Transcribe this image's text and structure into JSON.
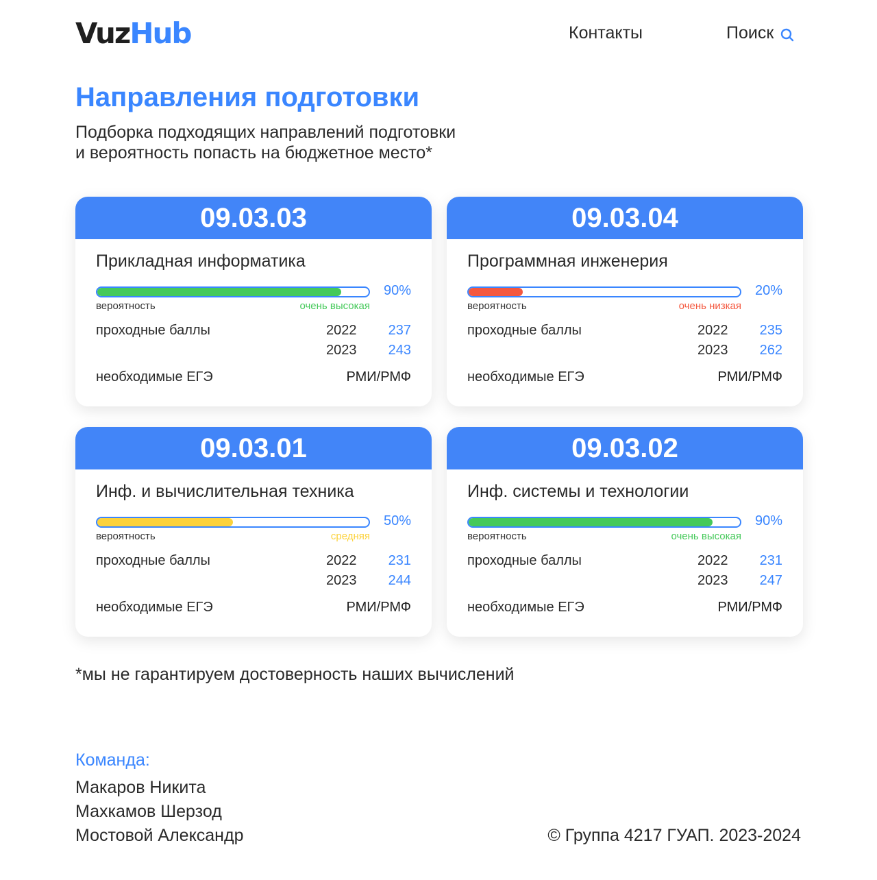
{
  "header": {
    "logo_part1": "Vuz",
    "logo_part2": "Hub",
    "nav_contacts": "Контакты",
    "nav_search": "Поиск"
  },
  "main": {
    "title": "Направления подготовки",
    "subtitle_line1": "Подборка подходящих направлений подготовки",
    "subtitle_line2": "и вероятность попасть на бюджетное место*"
  },
  "labels": {
    "probability": "вероятность",
    "passing_scores": "проходные баллы",
    "required_exams": "необходимые ЕГЭ"
  },
  "cards": [
    {
      "code": "09.03.03",
      "name": "Прикладная информатика",
      "probability_percent": 90,
      "probability_text": "90%",
      "probability_level": "очень высокая",
      "level_color": "#45c95a",
      "year1": "2022",
      "score1": "237",
      "year2": "2023",
      "score2": "243",
      "exams": "РМИ/РМФ"
    },
    {
      "code": "09.03.04",
      "name": "Программная инженерия",
      "probability_percent": 20,
      "probability_text": "20%",
      "probability_level": "очень низкая",
      "level_color": "#f4583f",
      "year1": "2022",
      "score1": "235",
      "year2": "2023",
      "score2": "262",
      "exams": "РМИ/РМФ"
    },
    {
      "code": "09.03.01",
      "name": "Инф. и вычислительная техника",
      "probability_percent": 50,
      "probability_text": "50%",
      "probability_level": "средняя",
      "level_color": "#fcd23c",
      "year1": "2022",
      "score1": "231",
      "year2": "2023",
      "score2": "244",
      "exams": "РМИ/РМФ"
    },
    {
      "code": "09.03.02",
      "name": "Инф. системы и технологии",
      "probability_percent": 90,
      "probability_text": "90%",
      "probability_level": "очень высокая",
      "level_color": "#45c95a",
      "year1": "2022",
      "score1": "231",
      "year2": "2023",
      "score2": "247",
      "exams": "РМИ/РМФ"
    }
  ],
  "disclaimer": "*мы не гарантируем достоверность наших вычислений",
  "footer": {
    "team_title": "Команда:",
    "members": [
      "Макаров Никита",
      "Махкамов Шерзод",
      "Мостовой Александр"
    ],
    "copyright": "© Группа 4217 ГУАП. 2023-2024"
  },
  "colors": {
    "accent": "#3a86ff",
    "card_header": "#4285f8"
  }
}
